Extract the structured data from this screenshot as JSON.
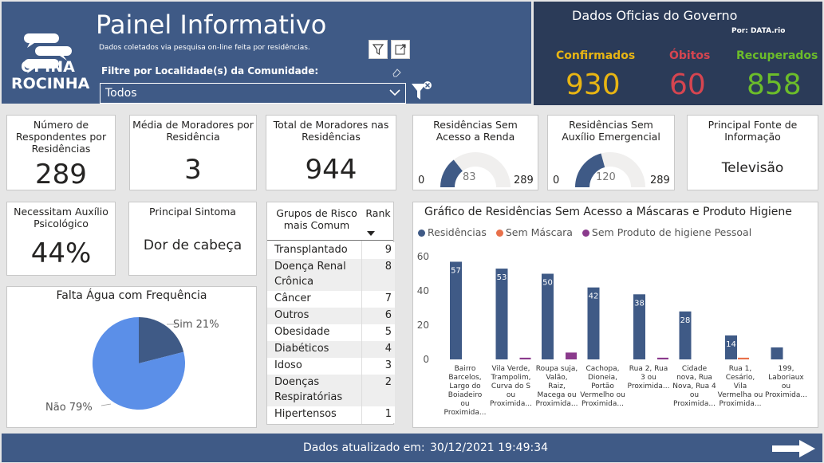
{
  "header": {
    "logo_line1": "OPINA",
    "logo_line2": "ROCINHA",
    "title": "Painel Informativo",
    "subtitle": "Dados coletados via pesquisa on-line feita por residências.",
    "filter_label": "Filtre por Localidade(s) da Comunidade:",
    "filter_value": "Todos",
    "icons": [
      "filter-icon",
      "focus-mode-icon",
      "eraser-icon",
      "clear-filter-icon"
    ]
  },
  "gov": {
    "title": "Dados Oficias do Governo",
    "by": "Por: DATA.rio",
    "confirmed_label": "Confirmados",
    "confirmed_value": "930",
    "deaths_label": "Óbitos",
    "deaths_value": "60",
    "recovered_label": "Recuperados",
    "recovered_value": "858",
    "colors": {
      "confirmed": "#e8b513",
      "deaths": "#d64550",
      "recovered": "#6cbd2a"
    }
  },
  "cards": {
    "respondents": {
      "title": "Número de Respondentes por Residências",
      "value": "289"
    },
    "avg_residents": {
      "title": "Média de Moradores por Residência",
      "value": "3"
    },
    "total_residents": {
      "title": "Total de Moradores nas Residências",
      "value": "944"
    },
    "no_income": {
      "title": "Residências Sem Acesso a Renda",
      "min": "0",
      "value": "83",
      "max": "289"
    },
    "no_aid": {
      "title": "Residências Sem Auxílio Emergencial",
      "min": "0",
      "value": "120",
      "max": "289"
    },
    "info_source": {
      "title": "Principal Fonte de Informação",
      "value": "Televisão"
    },
    "psych": {
      "title": "Necessitam Auxílio Psicológico",
      "value": "44%"
    },
    "symptom": {
      "title": "Principal Sintoma",
      "value": "Dor de cabeça"
    }
  },
  "risk_table": {
    "col1": "Grupos de Risco mais Comum",
    "col2": "Rank",
    "rows": [
      {
        "name": "Transplantado",
        "rank": "9"
      },
      {
        "name": "Doença Renal Crônica",
        "rank": "8"
      },
      {
        "name": "Câncer",
        "rank": "7"
      },
      {
        "name": "Outros",
        "rank": "6"
      },
      {
        "name": "Obesidade",
        "rank": "5"
      },
      {
        "name": "Diabéticos",
        "rank": "4"
      },
      {
        "name": "Idoso",
        "rank": "3"
      },
      {
        "name": "Doenças Respiratórias",
        "rank": "2"
      },
      {
        "name": "Hipertensos",
        "rank": "1"
      }
    ]
  },
  "water_pie": {
    "title": "Falta Água com Frequência",
    "slices": [
      {
        "label": "Sim 21%",
        "value": 21,
        "color": "#3f5a86"
      },
      {
        "label": "Não 79%",
        "value": 79,
        "color": "#5b8fe8"
      }
    ]
  },
  "chart_data": {
    "type": "bar",
    "title": "Gráfico de Residências Sem Acesso a Máscaras e Produto Higiene",
    "categories": [
      "Bairro Barcelos, Largo do Boiadeiro ou Proximida...",
      "Vila Verde, Trampolim, Curva do S ou Proximida...",
      "Roupa suja, Valão, Raiz, Macega ou Proximida...",
      "Cachopa, Dioneia, Portão Vermelho ou Proximida...",
      "Rua 2, Rua 3 ou Proximida...",
      "Cidade nova, Rua Nova, Rua 4 ou Proximida...",
      "Rua 1, Cesário, Vila Vermelha ou Proximida...",
      "199, Laboriaux ou Proximida..."
    ],
    "series": [
      {
        "name": "Residências",
        "color": "#3f5a86",
        "values": [
          57,
          53,
          50,
          42,
          38,
          28,
          14,
          7
        ]
      },
      {
        "name": "Sem Máscara",
        "color": "#e8704a",
        "values": [
          0,
          0,
          0,
          0,
          0,
          0,
          1,
          0
        ]
      },
      {
        "name": "Sem Produto de higiene Pessoal",
        "color": "#8a3a8c",
        "values": [
          0,
          1,
          4,
          0,
          1,
          0,
          0,
          0
        ]
      }
    ],
    "data_labels": [
      "57",
      "53",
      "50",
      "42",
      "38",
      "28",
      "14",
      ""
    ],
    "yticks": [
      "0",
      "20",
      "40",
      "60"
    ],
    "ylim": [
      0,
      65
    ],
    "legend_position": "top-left"
  },
  "footer": {
    "label": "Dados atualizado em:",
    "date": "30/12/2021 19:49:34"
  }
}
